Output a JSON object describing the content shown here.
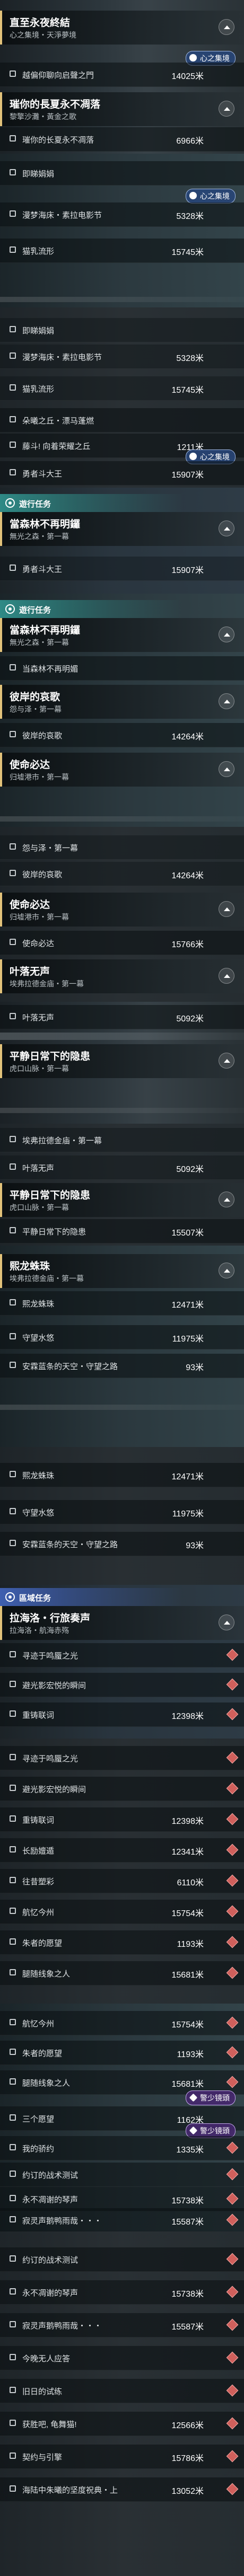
{
  "quests": {
    "q1": {
      "title": "直至永夜終結",
      "sub": "心之集境・天淨夢境"
    },
    "q2": {
      "title": "璀你的長夏永不凋落",
      "sub": "黎擎沙灘・黃金之歌"
    },
    "q3": {
      "title": "當森林不再明鑼",
      "sub": "無光之森・第一幕"
    },
    "q4": {
      "title": "當森林不再明鑼",
      "sub": "無光之森・第一幕"
    },
    "q5": {
      "title": "彼岸的哀歌",
      "sub": "怨与泽・第一幕"
    },
    "q6": {
      "title": "使命必达",
      "sub": "归墟港市・第一幕"
    },
    "q7": {
      "title": "使命必达",
      "sub": "归墟港市・第一幕"
    },
    "q8": {
      "title": "叶落无声",
      "sub": "埃弗拉德金庙・第一幕"
    },
    "q9": {
      "title": "平静日常下的隐患",
      "sub": "虎口山脉・第一幕"
    },
    "q10": {
      "title": "平静日常下的隐患",
      "sub": "虎口山脉・第一幕"
    },
    "q11": {
      "title": "熙龙蛛珠",
      "sub": "埃弗拉德金庙・第一幕"
    },
    "q12": {
      "title": "拉海洛・行旅奏声",
      "sub": "拉海洛・航海赤殇"
    }
  },
  "tags": {
    "side": "遊行任务",
    "side2": "遊行任务",
    "region": "區域任务"
  },
  "badges": {
    "heart": "心之集境",
    "heart2": "心之集境",
    "heart3": "心之集境",
    "warn": "警少镜頭",
    "warn2": "警少镜頭"
  },
  "rows": {
    "r1": {
      "label": "越偏仰聊向启聲之門",
      "value": "14025米"
    },
    "r2": {
      "label": "璀你的长夏永不凋落",
      "value": "6966米"
    },
    "r3": {
      "label": "即睇娟娟",
      "value": ""
    },
    "r4": {
      "label": "漫梦海床・素拉电影节",
      "value": "5328米"
    },
    "r5": {
      "label": "猫乳流形",
      "value": "15745米"
    },
    "r6": {
      "label": "即睇娟娟",
      "value": ""
    },
    "r7": {
      "label": "漫梦海床・素拉电影节",
      "value": "5328米"
    },
    "r8": {
      "label": "猫乳流形",
      "value": "15745米"
    },
    "r9": {
      "label": "朵曦之丘・漂马蓬燃",
      "value": ""
    },
    "r10": {
      "label": "藤斗! 向着荣耀之丘",
      "value": "1211米"
    },
    "r11": {
      "label": "勇者斗大王",
      "value": "15907米"
    },
    "r12": {
      "label": "勇者斗大王",
      "value": "15907米"
    },
    "r13": {
      "label": "当森林不再明媚",
      "value": ""
    },
    "r14": {
      "label": "彼岸的哀歌",
      "value": "14264米"
    },
    "r15": {
      "label": "怨与泽・第一幕",
      "value": ""
    },
    "r16": {
      "label": "彼岸的哀歌",
      "value": "14264米"
    },
    "r17": {
      "label": "使命必达",
      "value": "15766米"
    },
    "r18": {
      "label": "叶落无声",
      "value": "5092米"
    },
    "r19": {
      "label": "埃弗拉德金庙・第一幕",
      "value": ""
    },
    "r20": {
      "label": "叶落无声",
      "value": "5092米"
    },
    "r21": {
      "label": "平静日常下的隐患",
      "value": "15507米"
    },
    "r22": {
      "label": "熙龙蛛珠",
      "value": "12471米"
    },
    "r23": {
      "label": "守望水悠",
      "value": "11975米"
    },
    "r24": {
      "label": "安霖蓝条的天空・守望之路",
      "value": "93米"
    },
    "r25": {
      "label": "熙龙蛛珠",
      "value": "12471米"
    },
    "r26": {
      "label": "守望水悠",
      "value": "11975米"
    },
    "r27": {
      "label": "安霖蓝条的天空・守望之路",
      "value": "93米"
    },
    "r28": {
      "label": "寻迹于鸣蜃之光",
      "value": ""
    },
    "r29": {
      "label": "避光影宏悦的瞬间",
      "value": ""
    },
    "r30": {
      "label": "重铸联词",
      "value": "12398米"
    },
    "r31": {
      "label": "寻迹于鸣蜃之光",
      "value": ""
    },
    "r32": {
      "label": "避光影宏悦的瞬间",
      "value": ""
    },
    "r33": {
      "label": "重铸联词",
      "value": "12398米"
    },
    "r34": {
      "label": "长励嬗遁",
      "value": "12341米"
    },
    "r35": {
      "label": "往昔塑彩",
      "value": "6110米"
    },
    "r36": {
      "label": "航忆今州",
      "value": "15754米"
    },
    "r37": {
      "label": "朱者的愿望",
      "value": "1193米"
    },
    "r38": {
      "label": "腿随线象之人",
      "value": "15681米"
    },
    "r39": {
      "label": "航忆今州",
      "value": "15754米"
    },
    "r40": {
      "label": "朱者的愿望",
      "value": "1193米"
    },
    "r41": {
      "label": "腿随线象之人",
      "value": "15681米"
    },
    "r42": {
      "label": "三个愿望",
      "value": "1162米"
    },
    "r43": {
      "label": "我的骄约",
      "value": "1335米"
    },
    "r44": {
      "label": "约订的战术测试",
      "value": ""
    },
    "r45": {
      "label": "永不凋谢的琴声",
      "value": "15738米"
    },
    "r46": {
      "label": "寂灵声鹅鸭雨哉・・・",
      "value": "15587米"
    },
    "r47": {
      "label": "约订的战术测试",
      "value": ""
    },
    "r48": {
      "label": "永不凋谢的琴声",
      "value": "15738米"
    },
    "r49": {
      "label": "寂灵声鹅鸭雨哉・・・",
      "value": "15587米"
    },
    "r50": {
      "label": "今晚无人应答",
      "value": ""
    },
    "r51": {
      "label": "旧日的试练",
      "value": ""
    },
    "r52": {
      "label": "获胜吧, 龟舞猫!",
      "value": "12566米"
    },
    "r53": {
      "label": "契约与引擎",
      "value": "15786米"
    },
    "r54": {
      "label": "海陆中朱曦的坚度祝典・上",
      "value": "13052米"
    }
  }
}
